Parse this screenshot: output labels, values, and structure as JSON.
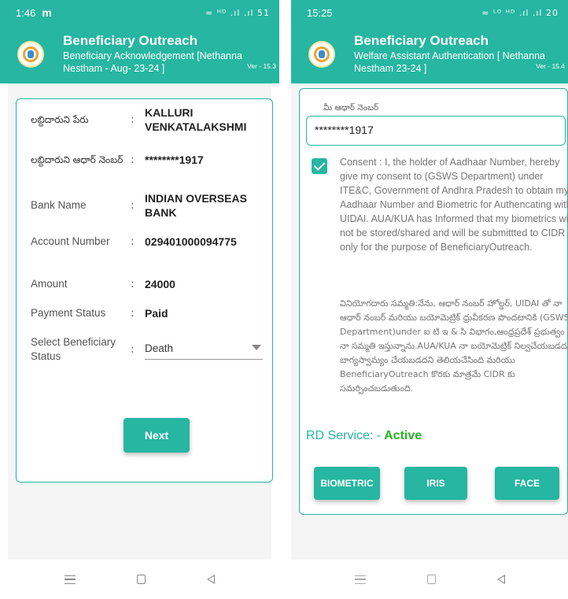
{
  "left_screen": {
    "status_bar": {
      "time": "1:46",
      "app_indicator": "m",
      "icons": "≈ ᴴᴰ .ıl .ıl 51"
    },
    "header": {
      "title": "Beneficiary Outreach",
      "subtitle": "Beneficiary Acknowledgement [Nethanna Nestham - Aug- 23-24 ]",
      "version": "Ver - 15.3"
    },
    "fields": [
      {
        "label": "లబ్దిదారుని పేరు",
        "value": "KALLURI VENKATALAKSHMI"
      },
      {
        "label": "లబ్దిదారుని ఆధార్ నెంబర్",
        "value": "********1917"
      },
      {
        "label": "Bank Name",
        "value": "INDIAN OVERSEAS BANK"
      },
      {
        "label": "Account Number",
        "value": "029401000094775"
      },
      {
        "label": "Amount",
        "value": "24000"
      },
      {
        "label": "Payment Status",
        "value": "Paid"
      },
      {
        "label": "Select Beneficiary Status",
        "value": "Death"
      }
    ],
    "colon": ":",
    "next_button": "Next"
  },
  "right_screen": {
    "status_bar": {
      "time": "15:25",
      "icons": "≈ ᴸᴼ ᴴᴰ .ıl .ıl 20"
    },
    "header": {
      "title": "Beneficiary Outreach",
      "subtitle": "Welfare Assistant Authentication [ Nethanna Nestham 23-24 ]",
      "version": "Ver - 15.4"
    },
    "aadhaar_label": "మీ ఆధార్ నెంబర్",
    "aadhaar_value": "********1917",
    "consent_checked": true,
    "consent_en": "Consent : I, the holder of Aadhaar Number, hereby give my consent to (GSWS Department) under ITE&C, Government of Andhra Pradesh to obtain my Aadhaar Number and Biometric for Authencating with UIDAI. AUA/KUA has Informed that my biometrics will not be stored/shared and will be submittted to CIDR only for the purpose of BeneficiaryOutreach.",
    "consent_te": "వినియోగదారు సమ్మతి:నేను, ఆధార్ నంబర్ హోల్డర్, UIDAI తో నా ఆధార్ నంబర్ మరియు బయోమెట్రిక్ ధ్రువీకరణ పొందటానికి (GSWS Department)under ఐ టి ఇ & సి విభాగం,ఆంధ్రప్రదేశ్ ప్రభుత్వం కి నా సమ్మతి ఇస్తున్నాను.AUA/KUA నా బయోమెట్రిక్ నిల్వచేయబడదు/బాగ్యస్వామ్యం చేయబడదని తెలియచేసింది మరియు BeneficiaryOutreach కొరకు మాత్రమే CIDR కు సమర్పించబడుతుంది.",
    "rd_service_label": "RD Service: -",
    "rd_service_status": "Active",
    "buttons": {
      "biometric": "BIOMETRIC",
      "iris": "IRIS",
      "face": "FACE"
    }
  },
  "colors": {
    "primary": "#26b6a1",
    "active_green": "#27b325"
  }
}
